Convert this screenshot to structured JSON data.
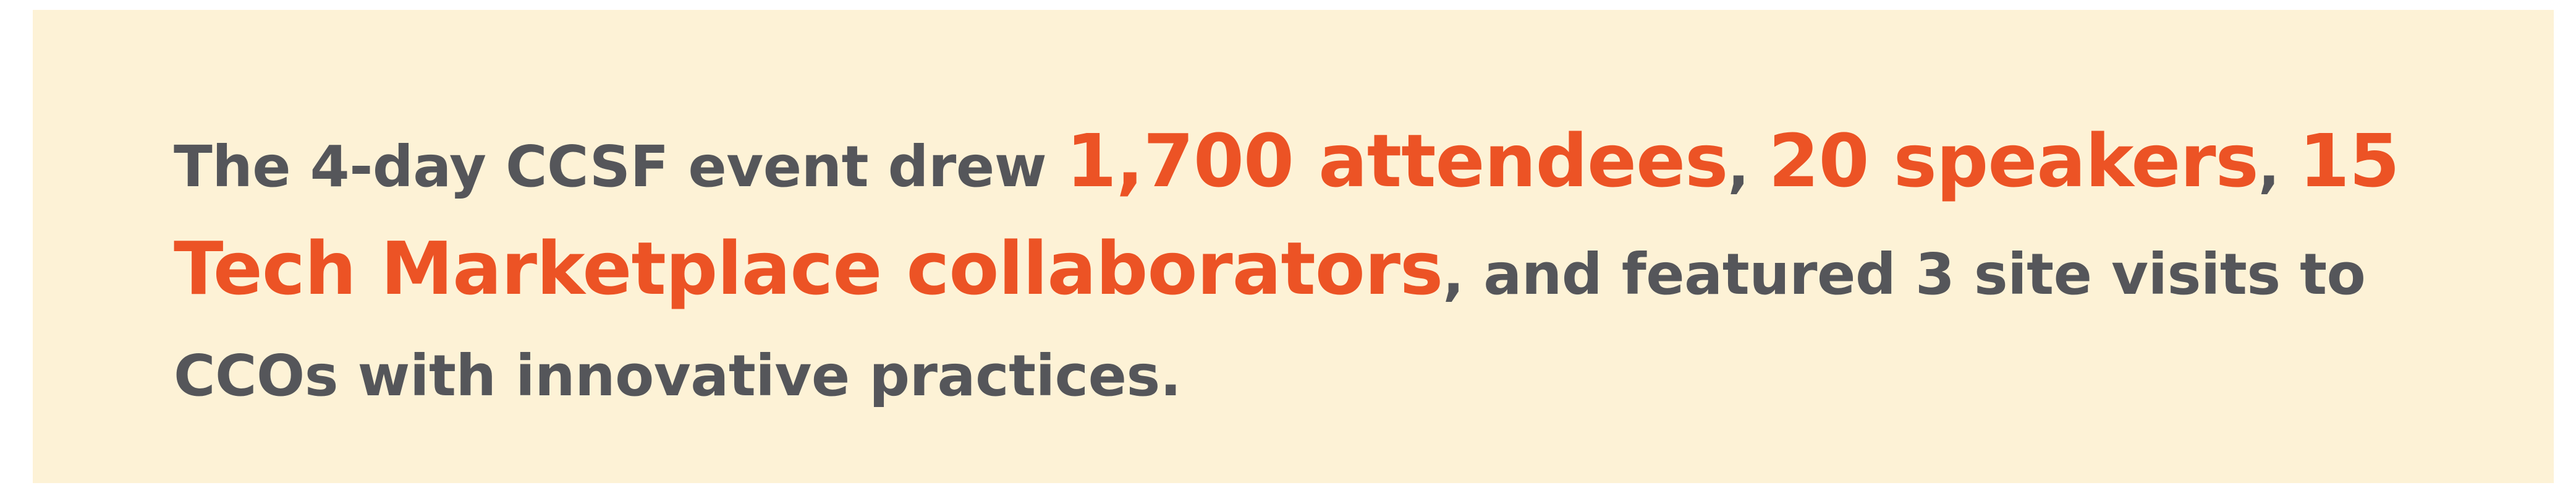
{
  "callout": {
    "background_color": "#fdf2d6",
    "text_color": "#55565a",
    "highlight_color": "#ec5325",
    "segments": {
      "intro": "The 4-day CCSF event drew ",
      "attendees": "1,700 attendees",
      "sep1": ", ",
      "speakers": "20 speakers",
      "sep2": ", ",
      "collaborators": "15 Tech Marketplace collaborators",
      "outro": ", and featured 3 site visits to CCOs with innovative practices."
    }
  }
}
